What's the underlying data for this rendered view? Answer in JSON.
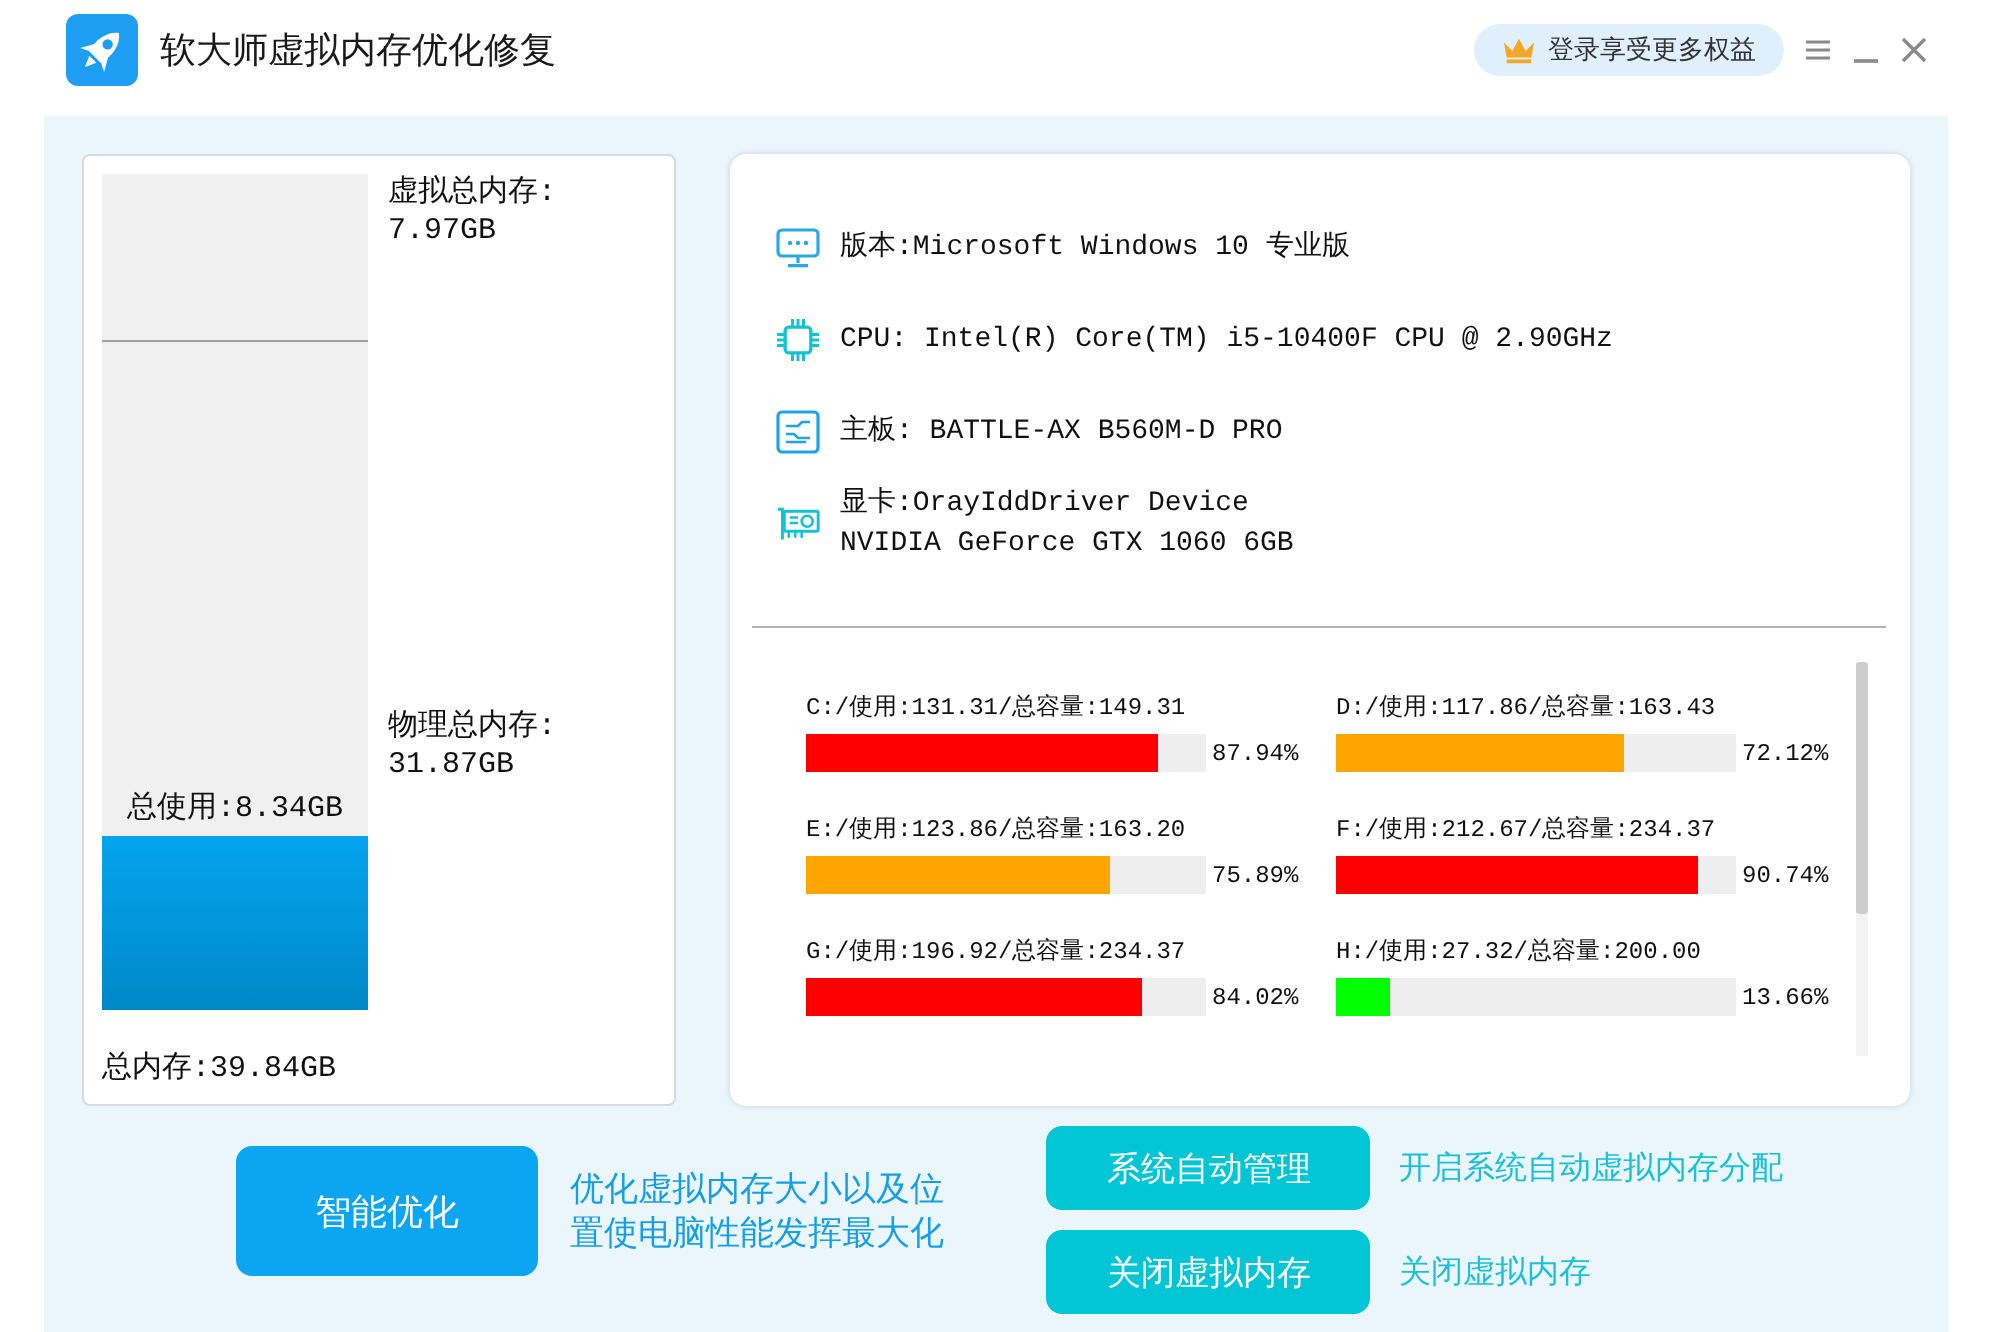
{
  "window": {
    "title": "软大师虚拟内存优化修复",
    "login_button": "登录享受更多权益"
  },
  "memory": {
    "virtual_label": "虚拟总内存:",
    "virtual_value": "7.97GB",
    "physical_label": "物理总内存:",
    "physical_value": "31.87GB",
    "used_label": "总使用:8.34GB",
    "total_label": "总内存:39.84GB",
    "bar": {
      "virtual": {
        "level": 0.2
      },
      "used": {
        "level": 0.209
      }
    }
  },
  "system_info": [
    {
      "kind": "os",
      "lines": [
        "版本:Microsoft Windows 10 专业版"
      ]
    },
    {
      "kind": "cpu",
      "lines": [
        "CPU: Intel(R) Core(TM) i5-10400F CPU @ 2.90GHz"
      ]
    },
    {
      "kind": "board",
      "lines": [
        "主板: BATTLE-AX B560M-D PRO"
      ]
    },
    {
      "kind": "gpu",
      "lines": [
        "显卡:OrayIddDriver Device",
        "NVIDIA GeForce GTX 1060 6GB"
      ]
    }
  ],
  "drives": [
    {
      "label": "C:/使用:131.31/总容量:149.31",
      "level": 0.8794,
      "reading": "87.94%",
      "color": "#ff0000"
    },
    {
      "label": "D:/使用:117.86/总容量:163.43",
      "level": 0.7212,
      "reading": "72.12%",
      "color": "#ffa500"
    },
    {
      "label": "E:/使用:123.86/总容量:163.20",
      "level": 0.7589,
      "reading": "75.89%",
      "color": "#ffa500"
    },
    {
      "label": "F:/使用:212.67/总容量:234.37",
      "level": 0.9074,
      "reading": "90.74%",
      "color": "#ff0000"
    },
    {
      "label": "G:/使用:196.92/总容量:234.37",
      "level": 0.8402,
      "reading": "84.02%",
      "color": "#ff0000"
    },
    {
      "label": "H:/使用:27.32/总容量:200.00",
      "level": 0.1366,
      "reading": "13.66%",
      "color": "#00ff00"
    }
  ],
  "actions": [
    {
      "kind": "primary",
      "label": "智能优化",
      "description": "优化虚拟内存大小以及位置使电脑性能发挥最大化"
    },
    {
      "kind": "secondary",
      "label": "系统自动管理",
      "description": "开启系统自动虚拟内存分配"
    },
    {
      "kind": "secondary",
      "label": "关闭虚拟内存",
      "description": "关闭虚拟内存"
    }
  ]
}
